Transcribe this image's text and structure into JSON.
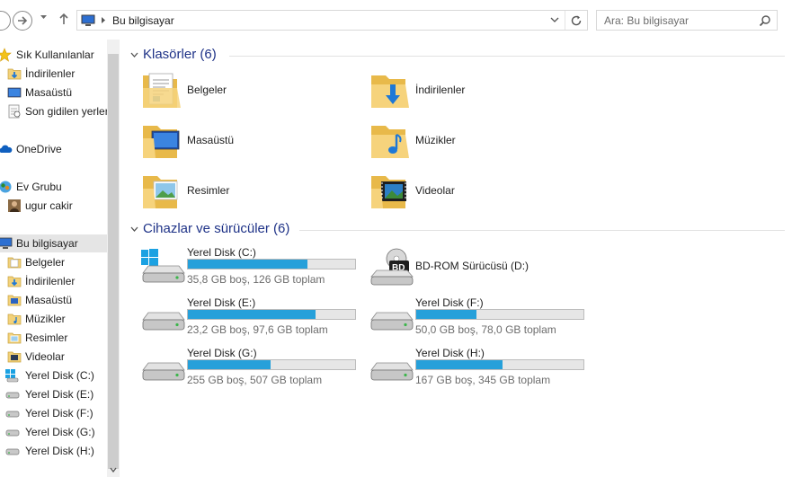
{
  "accent_color": "#26a0da",
  "address_bar": {
    "location": "Bu bilgisayar",
    "search_placeholder": "Ara: Bu bilgisayar"
  },
  "nav_pane": {
    "favorites": {
      "label": "Sık Kullanılanlar",
      "items": [
        "İndirilenler",
        "Masaüstü",
        "Son gidilen yerler"
      ]
    },
    "onedrive": "OneDrive",
    "homegroup": {
      "label": "Ev Grubu",
      "items": [
        "ugur cakir"
      ]
    },
    "this_pc": {
      "label": "Bu bilgisayar",
      "items": [
        "Belgeler",
        "İndirilenler",
        "Masaüstü",
        "Müzikler",
        "Resimler",
        "Videolar",
        "Yerel Disk (C:)",
        "Yerel Disk (E:)",
        "Yerel Disk (F:)",
        "Yerel Disk (G:)",
        "Yerel Disk (H:)"
      ]
    }
  },
  "folders_group": {
    "title": "Klasörler (6)",
    "items": [
      {
        "name": "Belgeler",
        "icon": "documents-folder-icon"
      },
      {
        "name": "İndirilenler",
        "icon": "downloads-folder-icon"
      },
      {
        "name": "Masaüstü",
        "icon": "desktop-folder-icon"
      },
      {
        "name": "Müzikler",
        "icon": "music-folder-icon"
      },
      {
        "name": "Resimler",
        "icon": "pictures-folder-icon"
      },
      {
        "name": "Videolar",
        "icon": "videos-folder-icon"
      }
    ]
  },
  "devices_group": {
    "title": "Cihazlar ve sürücüler (6)",
    "drives": [
      {
        "name": "Yerel Disk (C:)",
        "free_text": "35,8 GB boş, 126 GB toplam",
        "used_fraction": 0.716
      },
      {
        "name": "BD-ROM Sürücüsü (D:)",
        "free_text": "",
        "used_fraction": null
      },
      {
        "name": "Yerel Disk (E:)",
        "free_text": "23,2 GB boş, 97,6 GB toplam",
        "used_fraction": 0.762
      },
      {
        "name": "Yerel Disk (F:)",
        "free_text": "50,0 GB boş, 78,0 GB toplam",
        "used_fraction": 0.359
      },
      {
        "name": "Yerel Disk (G:)",
        "free_text": "255 GB boş, 507 GB toplam",
        "used_fraction": 0.497
      },
      {
        "name": "Yerel Disk (H:)",
        "free_text": "167 GB boş, 345 GB toplam",
        "used_fraction": 0.516
      }
    ]
  }
}
